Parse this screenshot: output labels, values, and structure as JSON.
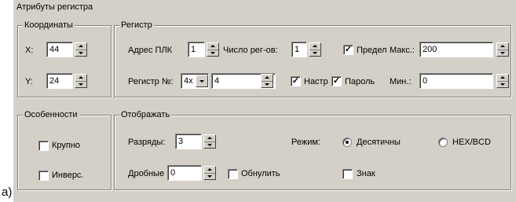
{
  "caption": "a)",
  "panel_title": "Атрибуты регистра",
  "coords": {
    "title": "Координаты",
    "x_label": "X:",
    "x_value": "44",
    "y_label": "Y:",
    "y_value": "24"
  },
  "register": {
    "title": "Регистр",
    "plc_addr_label": "Адрес ПЛК",
    "plc_addr_value": "1",
    "reg_count_label": "Число рег-ов:",
    "reg_count_value": "1",
    "limit_label": "Предел",
    "limit_checked": true,
    "max_label": "Макс.:",
    "max_value": "200",
    "reg_no_label": "Регистр №:",
    "reg_type_value": "4x",
    "reg_no_value": "4",
    "setup_label": "Настр",
    "setup_checked": true,
    "password_label": "Пароль",
    "password_checked": true,
    "min_label": "Мин.:",
    "min_value": "0"
  },
  "features": {
    "title": "Особенности",
    "large_label": "Крупно",
    "large_checked": false,
    "invert_label": "Инверс.",
    "invert_checked": false
  },
  "display": {
    "title": "Отображать",
    "digits_label": "Разряды:",
    "digits_value": "3",
    "mode_label": "Режим:",
    "decimal_label": "Десятичны",
    "decimal_selected": true,
    "hex_label": "HEX/BCD",
    "hex_selected": false,
    "fraction_label": "Дробные",
    "fraction_value": "0",
    "zero_label": "Обнулить",
    "zero_checked": false,
    "sign_label": "Знак",
    "sign_checked": false
  }
}
